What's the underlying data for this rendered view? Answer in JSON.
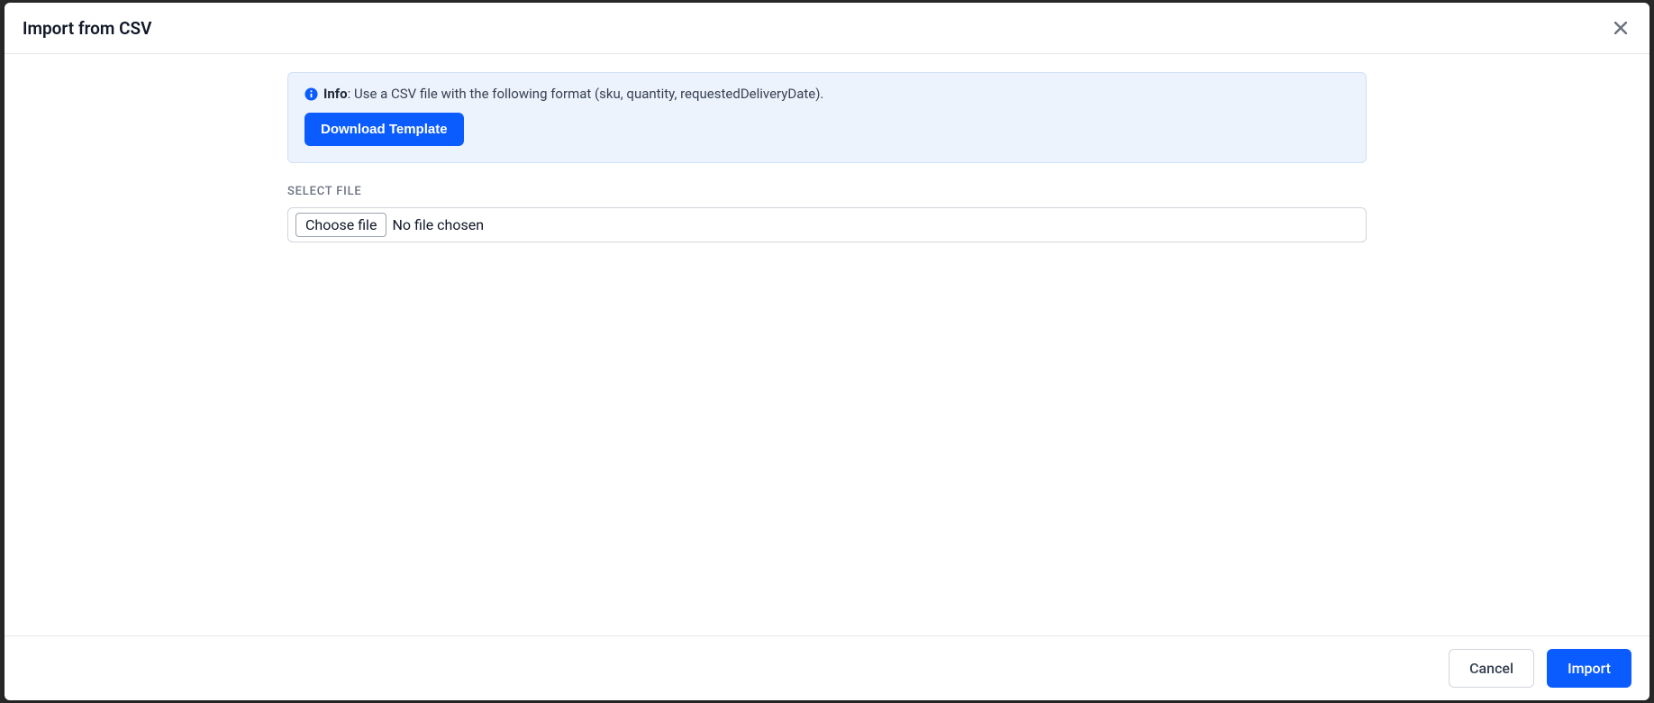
{
  "modal": {
    "title": "Import from CSV",
    "info": {
      "label": "Info",
      "message": ": Use a CSV file with the following format (sku, quantity, requestedDeliveryDate).",
      "download_button": "Download Template"
    },
    "file": {
      "label": "Select File",
      "choose_button": "Choose file",
      "status": "No file chosen"
    },
    "footer": {
      "cancel": "Cancel",
      "import": "Import"
    }
  }
}
